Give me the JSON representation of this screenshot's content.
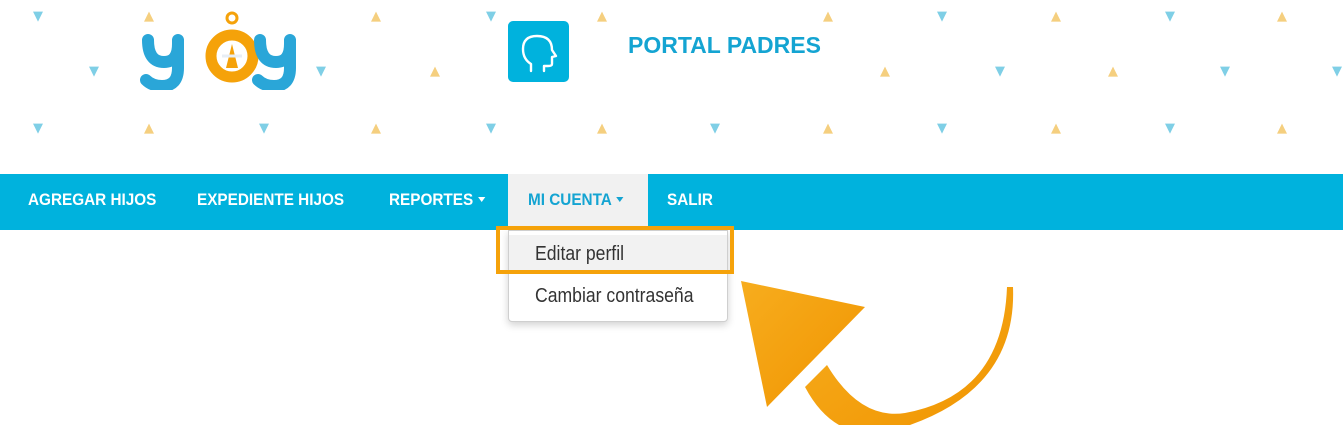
{
  "header": {
    "logo_text": "yoy",
    "portal_title": "PORTAL PADRES",
    "app_icon": "head-profile-icon"
  },
  "navbar": {
    "items": [
      {
        "label": "AGREGAR HIJOS"
      },
      {
        "label": "EXPEDIENTE HIJOS"
      },
      {
        "label": "REPORTES"
      },
      {
        "label": "MI CUENTA"
      },
      {
        "label": "SALIR"
      }
    ],
    "active": "MI CUENTA"
  },
  "dropdown": {
    "items": [
      {
        "label": "Editar perfil"
      },
      {
        "label": "Cambiar contraseña"
      }
    ]
  },
  "annotation": {
    "highlight_color": "#f5a20a",
    "arrow_color": "#f5a20a",
    "arrow_icon": "curved-arrow-icon"
  },
  "colors": {
    "navbar": "#00b2dd",
    "accent": "#14a4d2",
    "pattern_down": "#7fcfe6",
    "pattern_up": "#f5cf7f"
  }
}
